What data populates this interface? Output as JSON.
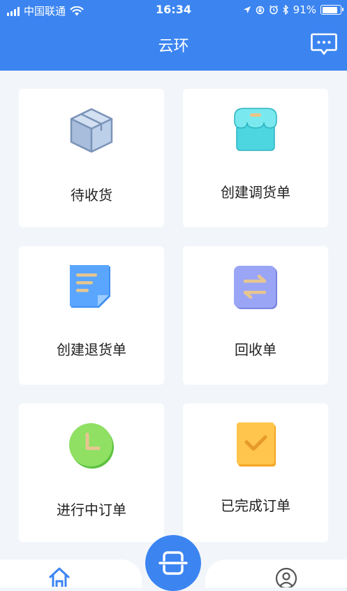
{
  "status_bar": {
    "carrier": "中国联通",
    "time": "16:34",
    "battery": "91%",
    "battery_level": 0.91
  },
  "header": {
    "title": "云环",
    "message_icon": "message-icon"
  },
  "tiles": [
    {
      "label": "待收货",
      "icon": "package-box-icon"
    },
    {
      "label": "创建调货单",
      "icon": "store-icon"
    },
    {
      "label": "创建退货单",
      "icon": "document-icon"
    },
    {
      "label": "回收单",
      "icon": "exchange-arrows-icon"
    },
    {
      "label": "进行中订单",
      "icon": "clock-icon"
    },
    {
      "label": "已完成订单",
      "icon": "checkmark-icon"
    }
  ],
  "tab_bar": {
    "home_icon": "home-icon",
    "scan_icon": "scan-icon",
    "user_icon": "user-icon"
  },
  "colors": {
    "accent": "#3c85f1",
    "background": "#f2f6fa"
  }
}
